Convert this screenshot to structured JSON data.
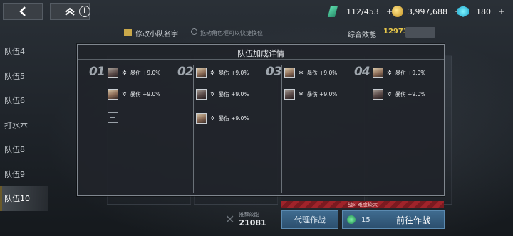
{
  "resources": {
    "stamina": "112/453",
    "coins": "3,997,688",
    "cores": "180",
    "plus": "+"
  },
  "team_header": {
    "rename_label": "修改小队名字",
    "hint": "拖动角色框可以快捷换位",
    "power_label": "综合效能",
    "power_value": "12973"
  },
  "sidebar": {
    "items": [
      {
        "label": "队伍4"
      },
      {
        "label": "队伍5"
      },
      {
        "label": "队伍6"
      },
      {
        "label": "打水本"
      },
      {
        "label": "队伍8"
      },
      {
        "label": "队伍9"
      },
      {
        "label": "队伍10"
      }
    ]
  },
  "modal": {
    "title": "队伍加成详情",
    "columns": [
      {
        "num": "01",
        "slots": [
          {
            "buff": "暴伤 +9.0%"
          },
          {
            "buff": "暴伤 +9.0%"
          }
        ]
      },
      {
        "num": "02",
        "slots": [
          {
            "buff": "暴伤 +9.0%"
          },
          {
            "buff": "暴伤 +9.0%"
          },
          {
            "buff": "暴伤 +9.0%"
          }
        ]
      },
      {
        "num": "03",
        "slots": [
          {
            "buff": "暴伤 +9.0%"
          },
          {
            "buff": "暴伤 +9.0%"
          }
        ]
      },
      {
        "num": "04",
        "slots": [
          {
            "buff": "暴伤 +9.0%"
          },
          {
            "buff": "暴伤 +9.0%"
          }
        ]
      }
    ]
  },
  "bottom": {
    "warning": "战斗难度较大",
    "rec_label": "推荐效能",
    "rec_value": "21081",
    "proxy_label": "代理作战",
    "go_cost": "15",
    "go_label": "前往作战"
  }
}
